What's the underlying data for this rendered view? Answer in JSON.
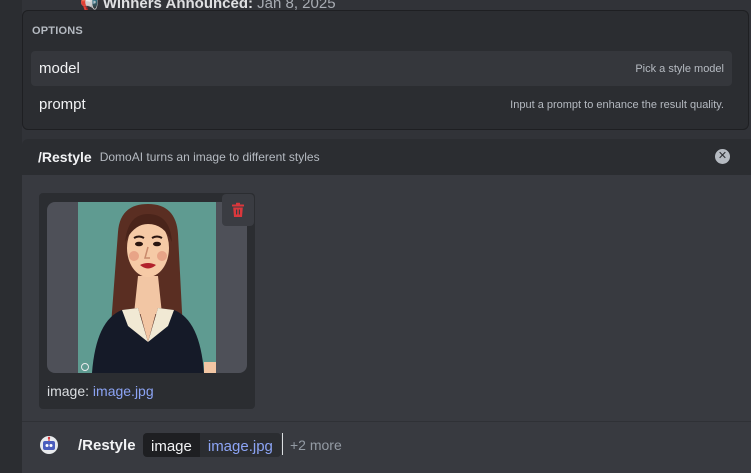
{
  "background": {
    "chat_message": "📢 Winners Announced:",
    "chat_date": "Jan 8, 2025"
  },
  "options_popup": {
    "title": "OPTIONS",
    "items": [
      {
        "name": "model",
        "description": "Pick a style model"
      },
      {
        "name": "prompt",
        "description": "Input a prompt to enhance the result quality."
      }
    ]
  },
  "command_panel": {
    "command": "/Restyle",
    "description": "DomoAI turns an image to different styles",
    "attachment": {
      "label_key": "image:",
      "filename": "image.jpg"
    }
  },
  "footer": {
    "command": "/Restyle",
    "param_name": "image",
    "param_value": "image.jpg",
    "more": "+2 more"
  },
  "colors": {
    "background": "#313338",
    "panel": "#383a40",
    "popup": "#2b2d31",
    "link": "#8ca4f5",
    "danger": "#da373c"
  }
}
